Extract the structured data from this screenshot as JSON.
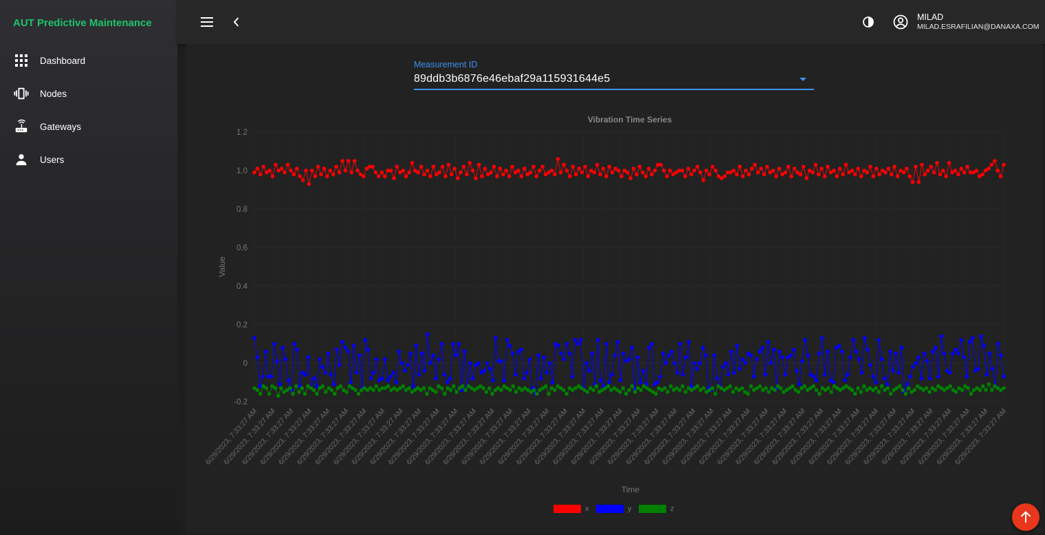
{
  "app": {
    "brand": "AUT Predictive Maintenance"
  },
  "sidebar": {
    "items": [
      {
        "label": "Dashboard",
        "icon": "apps-grid-icon"
      },
      {
        "label": "Nodes",
        "icon": "vibration-icon"
      },
      {
        "label": "Gateways",
        "icon": "router-icon"
      },
      {
        "label": "Users",
        "icon": "person-icon"
      }
    ]
  },
  "topbar": {
    "menu_icon": "menu-icon",
    "back_icon": "chevron-left-icon",
    "theme_icon": "contrast-icon",
    "user_icon": "account-circle-icon",
    "user_name": "MILAD",
    "user_email": "MILAD.ESRAFILIAN@DANAXA.COM"
  },
  "measurement": {
    "label": "Measurement ID",
    "value": "89ddb3b6876e46ebaf29a115931644e5"
  },
  "fab": {
    "icon": "arrow-up-icon"
  },
  "colors": {
    "accent": "#3d8ff0",
    "brand_green": "#1fc36b",
    "fab": "#e8371c",
    "series_x": "#ff0000",
    "series_y": "#0000ff",
    "series_z": "#008000"
  },
  "chart_data": {
    "type": "line",
    "title": "Vibration Time Series",
    "xlabel": "Time",
    "ylabel": "Value",
    "ylim": [
      -0.2,
      1.2
    ],
    "yticks": [
      -0.2,
      0,
      0.2,
      0.4,
      0.6,
      0.8,
      1.0,
      1.2
    ],
    "ytick_labels": [
      "-0.2",
      "0",
      "0.2",
      "0.4",
      "0.6",
      "0.8",
      "1.0",
      "1.2"
    ],
    "x_tick_label": "6/29/2023, 7:33:27 AM",
    "x_tick_count": 42,
    "legend": "bottom",
    "grid": true,
    "series": [
      {
        "name": "x",
        "color": "#ff0000",
        "values": [
          0.99,
          1.01,
          0.98,
          1.02,
          0.99,
          1.0,
          0.97,
          1.03,
          1.0,
          1.01,
          0.99,
          1.03,
          1.0,
          0.98,
          1.01,
          0.97,
          0.95,
          1.0,
          0.93,
          1.0,
          0.97,
          1.02,
          0.98,
          1.01,
          0.97,
          1.0,
          0.98,
          1.02,
          0.99,
          1.05,
          1.0,
          1.05,
          0.99,
          1.05,
          1.0,
          0.98,
          0.97,
          1.01,
          1.02,
          1.02,
          0.99,
          0.97,
          0.99,
          0.97,
          1.0,
          1.0,
          0.96,
          1.02,
          0.99,
          1.0,
          0.97,
          0.99,
          1.04,
          1.0,
          0.99,
          1.02,
          0.98,
          1.0,
          0.97,
          1.02,
          0.98,
          0.99,
          1.02,
          0.97,
          1.03,
          0.98,
          1.01,
          0.96,
          0.99,
          1.02,
          0.98,
          1.04,
          1.0,
          0.96,
          1.03,
          0.97,
          1.01,
          0.98,
          0.99,
          1.02,
          0.97,
          1.01,
          0.98,
          1.0,
          0.97,
          1.02,
          0.99,
          1.0,
          0.97,
          1.01,
          0.98,
          0.99,
          1.02,
          0.97,
          1.0,
          1.02,
          0.98,
          0.99,
          1.0,
          0.98,
          1.06,
          0.99,
          1.03,
          1.0,
          0.97,
          1.02,
          0.98,
          1.01,
          0.99,
          1.02,
          0.97,
          1.0,
          0.99,
          1.03,
          0.98,
          1.01,
          0.97,
          1.02,
          0.99,
          1.01,
          1.0,
          0.97,
          1.0,
          0.99,
          0.96,
          1.01,
          0.98,
          1.02,
          0.99,
          0.97,
          1.01,
          0.98,
          1.0,
          1.03,
          1.03,
          1.0,
          0.97,
          1.0,
          0.98,
          0.99,
          1.0,
          1.0,
          0.97,
          1.01,
          0.98,
          1.0,
          1.02,
          0.99,
          0.95,
          1.0,
          0.98,
          1.02,
          1.0,
          0.97,
          0.96,
          0.97,
          0.99,
          0.99,
          1.0,
          0.98,
          1.02,
          0.97,
          1.0,
          0.98,
          1.01,
          1.03,
          0.99,
          1.01,
          0.98,
          1.02,
          0.99,
          1.0,
          0.97,
          1.01,
          0.98,
          0.99,
          1.02,
          0.97,
          1.01,
          0.99,
          0.98,
          1.02,
          0.96,
          1.0,
          0.99,
          1.03,
          0.98,
          1.01,
          0.97,
          1.02,
          0.99,
          1.0,
          0.97,
          1.01,
          0.98,
          1.03,
          0.99,
          1.0,
          0.98,
          1.01,
          0.97,
          1.0,
          0.99,
          1.02,
          0.97,
          1.01,
          0.98,
          1.0,
          0.99,
          1.01,
          0.98,
          1.02,
          0.97,
          1.0,
          0.99,
          1.01,
          0.97,
          0.94,
          1.02,
          0.94,
          1.03,
          0.98,
          1.0,
          1.02,
          0.99,
          1.04,
          0.98,
          1.0,
          0.97,
          1.04,
          0.99,
          1.0,
          0.98,
          1.01,
          0.99,
          1.02,
          0.99,
          0.99,
          1.0,
          0.97,
          0.98,
          1.0,
          1.01,
          1.03,
          1.05,
          1.0,
          0.97,
          1.03
        ]
      },
      {
        "name": "y",
        "color": "#0000ff",
        "values": [
          0.13,
          0.03,
          -0.12,
          -0.07,
          0.06,
          -0.07,
          -0.07,
          0.1,
          0.01,
          -0.11,
          0.08,
          0.02,
          -0.09,
          -0.14,
          0.1,
          0.07,
          -0.12,
          -0.05,
          -0.06,
          0.03,
          -0.13,
          -0.08,
          -0.12,
          0.02,
          -0.02,
          -0.05,
          0.05,
          -0.06,
          -0.11,
          0.07,
          -0.01,
          0.11,
          0.08,
          0.06,
          -0.1,
          0.09,
          -0.05,
          0.04,
          -0.13,
          0.12,
          0.07,
          -0.08,
          -0.05,
          0.02,
          -0.09,
          -0.08,
          0.02,
          -0.09,
          -0.07,
          -0.05,
          -0.1,
          0.06,
          0.0,
          -0.04,
          -0.01,
          0.05,
          -0.12,
          0.09,
          -0.06,
          0.05,
          -0.04,
          0.15,
          0.0,
          0.04,
          -0.08,
          0.02,
          0.1,
          -0.06,
          -0.1,
          -0.08,
          0.1,
          0.04,
          0.1,
          -0.14,
          0.06,
          -0.12,
          0.0,
          -0.08,
          -0.01,
          0.0,
          -0.05,
          -0.04,
          0.0,
          -0.03,
          -0.09,
          0.13,
          0.01,
          0.01,
          -0.09,
          0.12,
          0.09,
          0.05,
          -0.06,
          0.06,
          0.07,
          -0.08,
          -0.05,
          0.02,
          -0.13,
          -0.16,
          0.04,
          -0.08,
          0.03,
          -0.05,
          0.0,
          -0.1,
          0.1,
          0.09,
          0.05,
          0.02,
          0.1,
          0.05,
          -0.07,
          0.12,
          0.1,
          0.12,
          -0.13,
          0.0,
          -0.04,
          0.05,
          -0.11,
          0.12,
          -0.09,
          -0.12,
          0.1,
          -0.1,
          -0.06,
          0.04,
          0.11,
          -0.09,
          0.05,
          0.01,
          0.02,
          0.08,
          -0.14,
          0.03,
          -0.1,
          -0.04,
          -0.11,
          0.08,
          0.1,
          -0.11,
          -0.1,
          -0.07,
          0.05,
          0.0,
          0.04,
          0.06,
          0.0,
          -0.05,
          0.1,
          -0.06,
          0.03,
          0.11,
          -0.12,
          0.0,
          -0.03,
          0.0,
          0.08,
          0.04,
          -0.13,
          -0.14,
          0.04,
          -0.08,
          -0.12,
          -0.02,
          0.0,
          -0.06,
          0.06,
          -0.05,
          0.09,
          -0.03,
          0.02,
          0.0,
          0.05,
          0.04,
          -0.07,
          0.02,
          0.06,
          0.08,
          -0.06,
          0.11,
          0.0,
          0.07,
          -0.13,
          0.06,
          0.03,
          -0.06,
          0.03,
          0.04,
          0.07,
          -0.04,
          -0.11,
          0.01,
          0.12,
          0.04,
          -0.06,
          -0.07,
          -0.09,
          0.05,
          0.13,
          -0.06,
          0.06,
          -0.09,
          -0.1,
          0.08,
          0.09,
          0.06,
          -0.09,
          -0.06,
          0.03,
          0.12,
          0.06,
          0.02,
          -0.05,
          0.13,
          0.07,
          -0.01,
          -0.07,
          -0.1,
          0.12,
          0.02,
          -0.08,
          -0.11,
          0.06,
          -0.04,
          0.05,
          -0.05,
          0.08,
          -0.15,
          -0.11,
          -0.07,
          -0.02,
          0.0,
          0.03,
          -0.08,
          0.05,
          0.01,
          -0.08,
          0.06,
          0.08,
          -0.07,
          0.14,
          0.05,
          -0.04,
          -0.05,
          0.05,
          0.07,
          0.05,
          0.12,
          0.03,
          -0.07,
          0.11,
          0.13,
          -0.04,
          -0.03,
          0.14,
          0.09,
          -0.06,
          0.05,
          -0.03,
          -0.12,
          0.1,
          0.04,
          -0.07
        ]
      },
      {
        "name": "z",
        "color": "#008000",
        "values": [
          -0.13,
          -0.14,
          -0.16,
          -0.12,
          -0.13,
          -0.16,
          -0.12,
          -0.13,
          -0.17,
          -0.13,
          -0.15,
          -0.14,
          -0.13,
          -0.16,
          -0.12,
          -0.15,
          -0.13,
          -0.16,
          -0.12,
          -0.13,
          -0.14,
          -0.16,
          -0.13,
          -0.12,
          -0.15,
          -0.13,
          -0.14,
          -0.16,
          -0.13,
          -0.12,
          -0.14,
          -0.15,
          -0.12,
          -0.13,
          -0.14,
          -0.16,
          -0.14,
          -0.13,
          -0.14,
          -0.13,
          -0.14,
          -0.12,
          -0.14,
          -0.13,
          -0.13,
          -0.12,
          -0.14,
          -0.13,
          -0.14,
          -0.13,
          -0.12,
          -0.14,
          -0.13,
          -0.15,
          -0.14,
          -0.13,
          -0.14,
          -0.13,
          -0.16,
          -0.13,
          -0.14,
          -0.15,
          -0.12,
          -0.13,
          -0.16,
          -0.13,
          -0.14,
          -0.12,
          -0.15,
          -0.13,
          -0.12,
          -0.14,
          -0.12,
          -0.13,
          -0.14,
          -0.13,
          -0.12,
          -0.13,
          -0.15,
          -0.13,
          -0.16,
          -0.14,
          -0.13,
          -0.14,
          -0.12,
          -0.13,
          -0.14,
          -0.12,
          -0.15,
          -0.13,
          -0.14,
          -0.13,
          -0.14,
          -0.15,
          -0.14,
          -0.16,
          -0.14,
          -0.13,
          -0.12,
          -0.16,
          -0.13,
          -0.14,
          -0.12,
          -0.13,
          -0.14,
          -0.16,
          -0.13,
          -0.14,
          -0.13,
          -0.12,
          -0.13,
          -0.14,
          -0.15,
          -0.13,
          -0.14,
          -0.12,
          -0.15,
          -0.14,
          -0.13,
          -0.12,
          -0.14,
          -0.13,
          -0.14,
          -0.15,
          -0.13,
          -0.16,
          -0.14,
          -0.12,
          -0.15,
          -0.13,
          -0.14,
          -0.12,
          -0.13,
          -0.14,
          -0.15,
          -0.16,
          -0.13,
          -0.14,
          -0.13,
          -0.15,
          -0.12,
          -0.14,
          -0.13,
          -0.14,
          -0.12,
          -0.15,
          -0.13,
          -0.14,
          -0.13,
          -0.12,
          -0.14,
          -0.13,
          -0.15,
          -0.14,
          -0.13,
          -0.16,
          -0.12,
          -0.13,
          -0.14,
          -0.13,
          -0.12,
          -0.15,
          -0.13,
          -0.14,
          -0.13,
          -0.15,
          -0.16,
          -0.12,
          -0.14,
          -0.13,
          -0.12,
          -0.14,
          -0.13,
          -0.15,
          -0.13,
          -0.14,
          -0.12,
          -0.13,
          -0.15,
          -0.14,
          -0.13,
          -0.12,
          -0.14,
          -0.15,
          -0.13,
          -0.12,
          -0.14,
          -0.13,
          -0.12,
          -0.14,
          -0.16,
          -0.13,
          -0.14,
          -0.13,
          -0.15,
          -0.12,
          -0.13,
          -0.14,
          -0.13,
          -0.12,
          -0.13,
          -0.14,
          -0.16,
          -0.13,
          -0.15,
          -0.12,
          -0.14,
          -0.13,
          -0.14,
          -0.13,
          -0.15,
          -0.12,
          -0.14,
          -0.13,
          -0.16,
          -0.14,
          -0.13,
          -0.12,
          -0.14,
          -0.16,
          -0.13,
          -0.15,
          -0.14,
          -0.12,
          -0.13,
          -0.14,
          -0.13,
          -0.15,
          -0.13,
          -0.14,
          -0.12,
          -0.13,
          -0.14,
          -0.13,
          -0.12,
          -0.14,
          -0.15,
          -0.13,
          -0.14,
          -0.12,
          -0.13,
          -0.16,
          -0.14,
          -0.13,
          -0.14,
          -0.12,
          -0.14,
          -0.11,
          -0.14,
          -0.12,
          -0.13,
          -0.14,
          -0.13
        ]
      }
    ]
  }
}
